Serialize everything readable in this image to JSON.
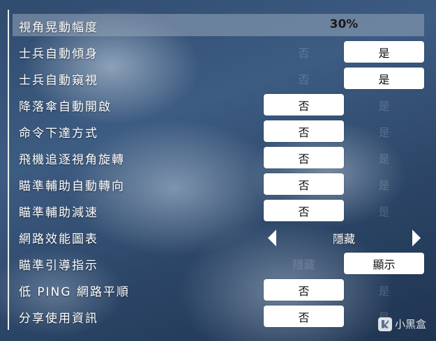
{
  "settings": [
    {
      "label": "視角晃動幅度",
      "type": "value",
      "value": "30%"
    },
    {
      "label": "士兵自動傾身",
      "type": "toggle",
      "off": "否",
      "on": "是",
      "selected": "on"
    },
    {
      "label": "士兵自動窺視",
      "type": "toggle",
      "off": "否",
      "on": "是",
      "selected": "on"
    },
    {
      "label": "降落傘自動開啟",
      "type": "toggle",
      "off": "否",
      "on": "是",
      "selected": "off"
    },
    {
      "label": "命令下達方式",
      "type": "toggle",
      "off": "否",
      "on": "是",
      "selected": "off"
    },
    {
      "label": "飛機追逐視角旋轉",
      "type": "toggle",
      "off": "否",
      "on": "是",
      "selected": "off"
    },
    {
      "label": "瞄準輔助自動轉向",
      "type": "toggle",
      "off": "否",
      "on": "是",
      "selected": "off"
    },
    {
      "label": "瞄準輔助減速",
      "type": "toggle",
      "off": "否",
      "on": "是",
      "selected": "off"
    },
    {
      "label": "網路效能圖表",
      "type": "select",
      "value": "隱藏"
    },
    {
      "label": "瞄準引導指示",
      "type": "toggle",
      "off": "隱藏",
      "on": "顯示",
      "selected": "on"
    },
    {
      "label": "低 PING 網路平順",
      "type": "toggle",
      "off": "否",
      "on": "是",
      "selected": "off"
    },
    {
      "label": "分享使用資訊",
      "type": "toggle",
      "off": "否",
      "on": "是",
      "selected": "off"
    }
  ],
  "watermark": {
    "text": "小黑盒",
    "icon": "xiaoheihe-logo-icon"
  }
}
